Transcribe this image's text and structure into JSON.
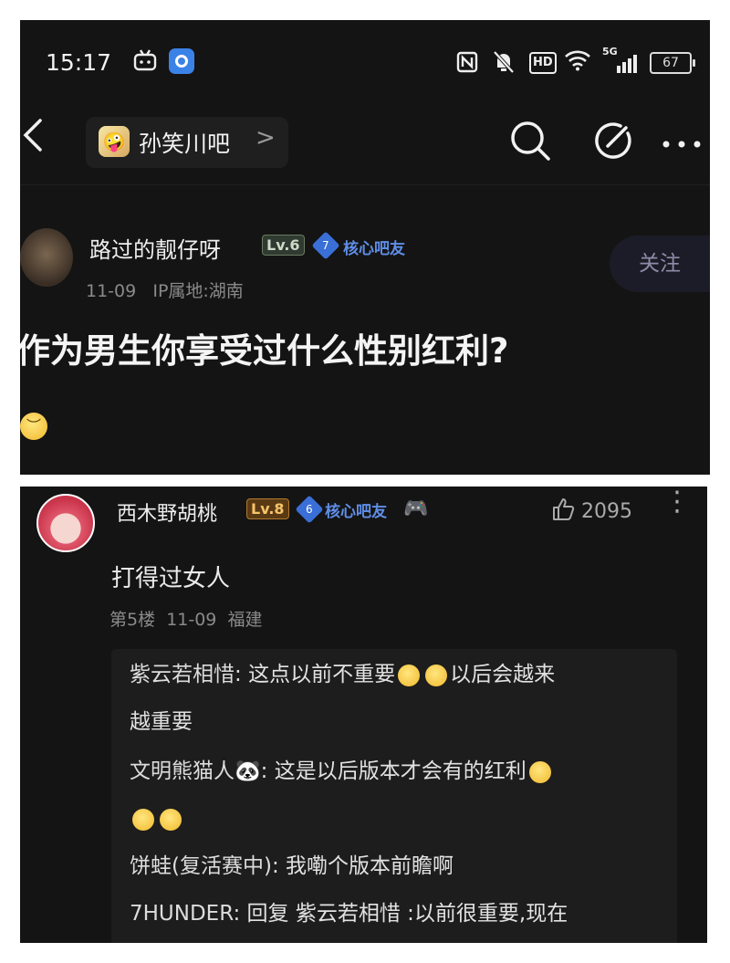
{
  "status_bar": {
    "time": "15:17",
    "hd_label": "HD",
    "signal_label": "5G",
    "battery": "67"
  },
  "nav": {
    "forum_name": "孙笑川吧",
    "forum_chevron": ">"
  },
  "post": {
    "author": "路过的靓仔呀",
    "level": "Lv.6",
    "badge_number": "7",
    "badge_label": "核心吧友",
    "follow_label": "关注",
    "date": "11-09",
    "ip_location": "IP属地:湖南",
    "title": "作为男生你享受过什么性别红利?"
  },
  "comment": {
    "author": "西木野胡桃",
    "level": "Lv.8",
    "badge_number": "6",
    "badge_label": "核心吧友",
    "likes": "2095",
    "body": "打得过女人",
    "floor": "第5楼",
    "date": "11-09",
    "location": "福建",
    "replies": [
      {
        "name": "紫云若相惜",
        "sep": ":",
        "text": "这点以前不重要",
        "text2": "以后会越来",
        "line2": "越重要"
      },
      {
        "name": "文明熊猫人🐼",
        "sep": ":",
        "text": "这是以后版本才会有的红利"
      },
      {
        "name": "饼蛙(复活赛中)",
        "sep": ":",
        "text": "我嘞个版本前瞻啊"
      },
      {
        "name": "7HUNDER",
        "sep": ":",
        "text": "回复 紫云若相惜 :以前很重要,现在"
      }
    ]
  },
  "colors": {
    "background": "#141414",
    "core_badge": "#5f8ee8",
    "level8": "#f5c46a"
  }
}
